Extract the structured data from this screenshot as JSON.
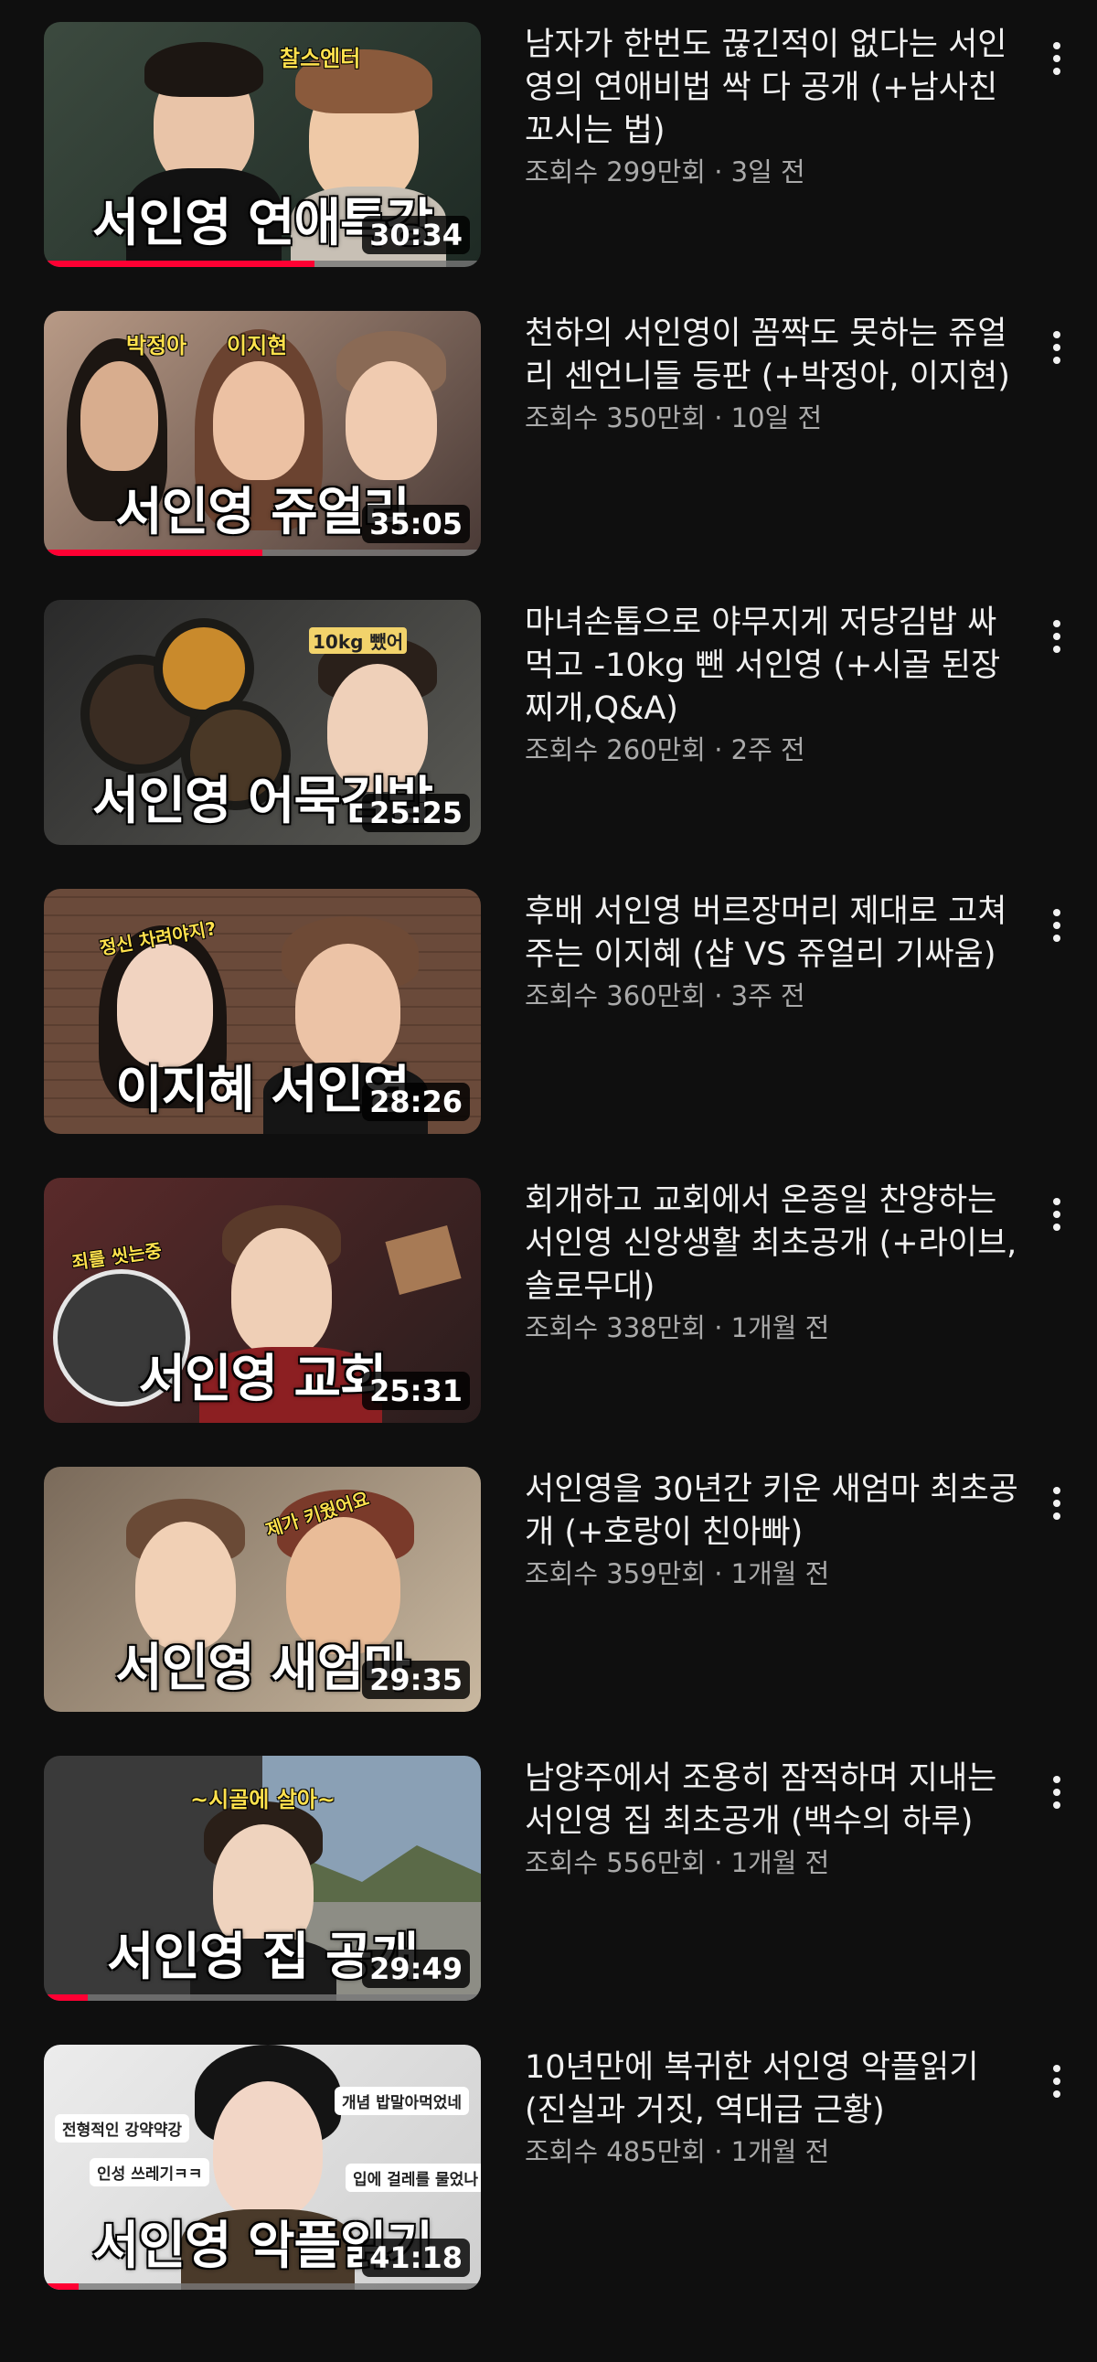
{
  "videos": [
    {
      "title": "남자가 한번도 끊긴적이 없다는 서인영의 연애비법 싹 다 공개 (+남사친 꼬시는 법)",
      "views": "조회수 299만회",
      "age": "3일 전",
      "duration": "30:34",
      "thumb_text": "서인영 연애특강",
      "callouts": [
        "찰스엔터"
      ],
      "watched_fraction": 0.62
    },
    {
      "title": "천하의 서인영이 꼼짝도 못하는 쥬얼리 센언니들 등판 (+박정아, 이지현)",
      "views": "조회수 350만회",
      "age": "10일 전",
      "duration": "35:05",
      "thumb_text": "서인영 쥬얼리",
      "callouts": [
        "박정아",
        "이지현"
      ],
      "watched_fraction": 0.5
    },
    {
      "title": "마녀손톱으로 야무지게 저당김밥 싸먹고 -10kg 뺀 서인영 (+시골 된장찌개,Q&A)",
      "views": "조회수 260만회",
      "age": "2주 전",
      "duration": "25:25",
      "thumb_text": "서인영 어묵김밥",
      "callouts": [
        "10kg 뺐어"
      ],
      "watched_fraction": 0
    },
    {
      "title": "후배 서인영 버르장머리 제대로 고쳐주는 이지혜 (샵 VS 쥬얼리 기싸움)",
      "views": "조회수 360만회",
      "age": "3주 전",
      "duration": "28:26",
      "thumb_text": "이지혜 서인영",
      "callouts": [
        "정신 차려야지?"
      ],
      "watched_fraction": 0
    },
    {
      "title": "회개하고 교회에서 온종일 찬양하는 서인영 신앙생활 최초공개 (+라이브, 솔로무대)",
      "views": "조회수 338만회",
      "age": "1개월 전",
      "duration": "25:31",
      "thumb_text": "서인영 교회",
      "callouts": [
        "죄를 씻는중"
      ],
      "watched_fraction": 0
    },
    {
      "title": "서인영을 30년간 키운 새엄마 최초공개 (+호랑이 친아빠)",
      "views": "조회수 359만회",
      "age": "1개월 전",
      "duration": "29:35",
      "thumb_text": "서인영 새엄마",
      "callouts": [
        "제가 키웠어요"
      ],
      "watched_fraction": 0
    },
    {
      "title": "남양주에서 조용히 잠적하며 지내는 서인영 집 최초공개 (백수의 하루)",
      "views": "조회수 556만회",
      "age": "1개월 전",
      "duration": "29:49",
      "thumb_text": "서인영 집 공개",
      "callouts": [
        "~시골에 살아~"
      ],
      "watched_fraction": 0.1
    },
    {
      "title": "10년만에 복귀한 서인영 악플읽기 (진실과 거짓, 역대급 근황)",
      "views": "조회수 485만회",
      "age": "1개월 전",
      "duration": "41:18",
      "thumb_text": "서인영 악플읽기",
      "callouts": [
        "전형적인 강약약강",
        "인성 쓰레기ㅋㅋ",
        "개념 밥말아먹었네",
        "입에 걸레를 물었나"
      ],
      "watched_fraction": 0.08
    }
  ],
  "colors": {
    "background": "#0f0f0f",
    "progress": "#ff0033",
    "meta_text": "#aaaaaa"
  },
  "icons": {
    "menu": "more-vert-icon"
  }
}
